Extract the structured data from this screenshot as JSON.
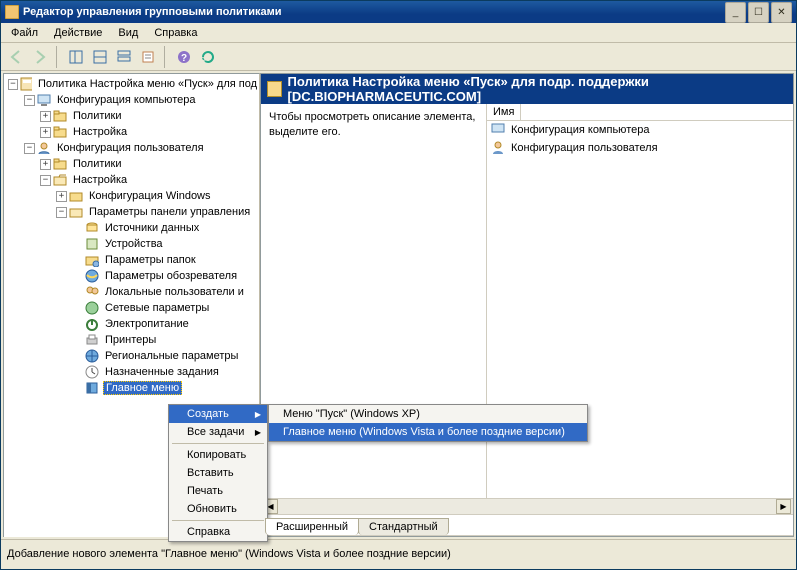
{
  "window": {
    "title": "Редактор управления групповыми политиками",
    "minimize": "_",
    "maximize": "☐",
    "close": "✕"
  },
  "menubar": [
    "Файл",
    "Действие",
    "Вид",
    "Справка"
  ],
  "tree": {
    "root": "Политика Настройка меню «Пуск» для под",
    "cc": "Конфигурация компьютера",
    "cc_pol": "Политики",
    "cc_pref": "Настройка",
    "uc": "Конфигурация пользователя",
    "uc_pol": "Политики",
    "uc_pref": "Настройка",
    "wincfg": "Конфигурация Windows",
    "cpanel": "Параметры панели управления",
    "datasources": "Источники данных",
    "devices": "Устройства",
    "folderopts": "Параметры папок",
    "ieopts": "Параметры обозревателя",
    "localusers": "Локальные пользователи и",
    "netopts": "Сетевые параметры",
    "power": "Электропитание",
    "printers": "Принтеры",
    "regional": "Региональные параметры",
    "schedtasks": "Назначенные задания",
    "startmenu": "Главное меню"
  },
  "policy_title": "Политика Настройка меню «Пуск» для подр. поддержки [DC.BIOPHARMACEUTIC.COM]",
  "description": "Чтобы просмотреть описание элемента, выделите его.",
  "lv_col": "Имя",
  "lv_rows": [
    "Конфигурация компьютера",
    "Конфигурация пользователя"
  ],
  "tabs": {
    "ext": "Расширенный",
    "std": "Стандартный"
  },
  "statusbar": "Добавление нового элемента \"Главное меню\" (Windows Vista и более поздние версии)",
  "ctx": {
    "create": "Создать",
    "alltasks": "Все задачи",
    "copy": "Копировать",
    "paste": "Вставить",
    "print": "Печать",
    "refresh": "Обновить",
    "help": "Справка",
    "sub1": "Меню \"Пуск\" (Windows XP)",
    "sub2": "Главное меню (Windows Vista и более поздние версии)"
  }
}
